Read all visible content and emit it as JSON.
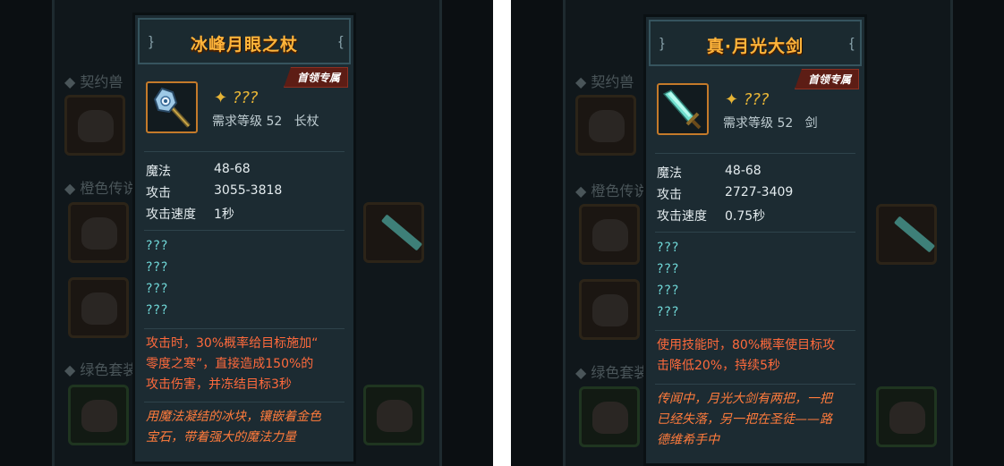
{
  "left": {
    "bg": {
      "sections": [
        "契约兽",
        "橙色传说",
        "绿色套装"
      ]
    },
    "tooltip": {
      "title": "冰峰月眼之杖",
      "badge": "首领专属",
      "rarity": "???",
      "requirement": "需求等级 52",
      "weapon_type": "长杖",
      "stats": [
        {
          "label": "魔法",
          "value": "48-68"
        },
        {
          "label": "攻击",
          "value": "3055-3818"
        },
        {
          "label": "攻击速度",
          "value": "1秒"
        }
      ],
      "unknowns": [
        "???",
        "???",
        "???",
        "???"
      ],
      "effect_lines": [
        "攻击时，30%概率给目标施加“",
        "零度之寒”，直接造成150%的",
        "攻击伤害，并冻结目标3秒"
      ],
      "lore_lines": [
        "用魔法凝结的冰块，镶嵌着金色",
        "宝石，带着强大的魔法力量"
      ],
      "icon": "ice-staff-icon"
    }
  },
  "right": {
    "bg": {
      "sections": [
        "契约兽",
        "橙色传说",
        "绿色套装"
      ]
    },
    "tooltip": {
      "title": "真·月光大剑",
      "badge": "首领专属",
      "rarity": "???",
      "requirement": "需求等级 52",
      "weapon_type": "剑",
      "stats": [
        {
          "label": "魔法",
          "value": "48-68"
        },
        {
          "label": "攻击",
          "value": "2727-3409"
        },
        {
          "label": "攻击速度",
          "value": "0.75秒"
        }
      ],
      "unknowns": [
        "???",
        "???",
        "???",
        "???"
      ],
      "effect_lines": [
        "使用技能时，80%概率使目标攻",
        "击降低20%，持续5秒"
      ],
      "lore_lines": [
        "传闻中，月光大剑有两把，一把",
        "已经失落，另一把在圣徒——路",
        "德维希手中"
      ],
      "icon": "moonlight-sword-icon"
    }
  },
  "colors": {
    "title": "#ffb43a",
    "badge": "#5d1d15",
    "unknown": "#6fd6d6",
    "effect": "#ff6a3c",
    "rarity": "#e6b436"
  }
}
